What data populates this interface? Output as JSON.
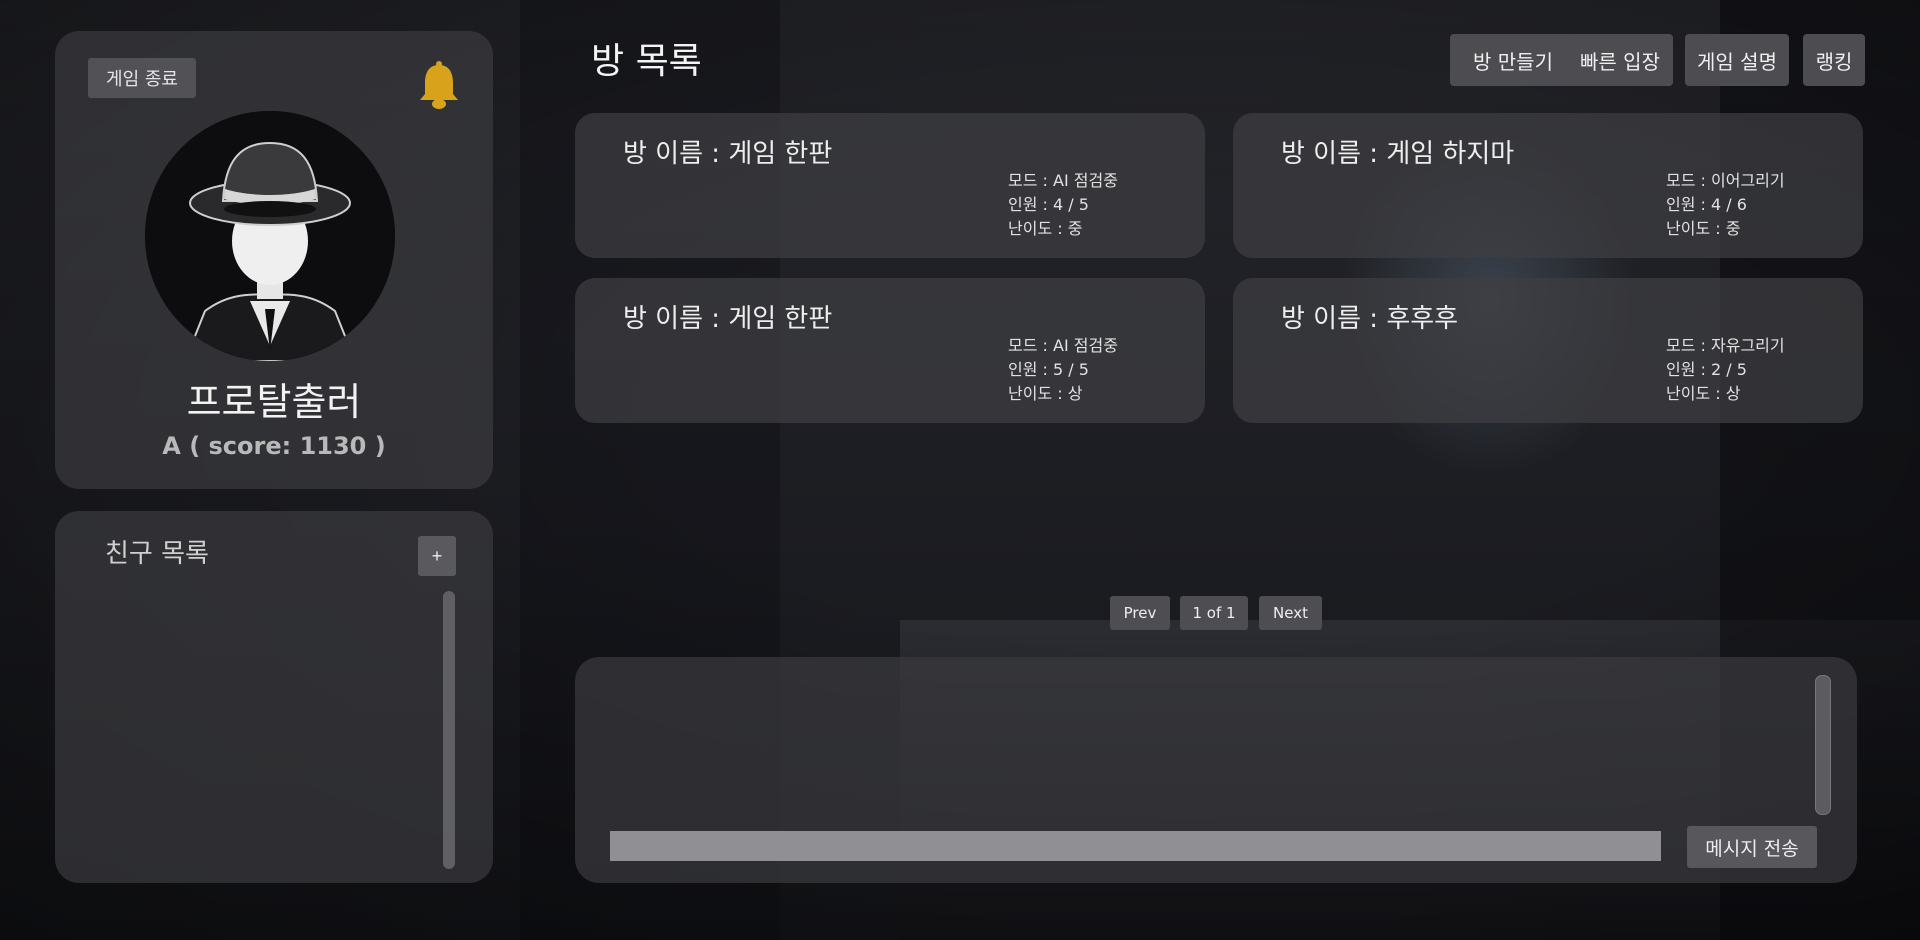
{
  "profile": {
    "exit_label": "게임 종료",
    "nickname": "프로탈출러",
    "score_text": "A ( score: 1130 )",
    "bell_color": "#d9a21b"
  },
  "friends": {
    "title": "친구 목록",
    "add_label": "+"
  },
  "rooms": {
    "title": "방 목록",
    "buttons": {
      "create": "방 만들기",
      "quick": "빠른 입장",
      "help": "게임 설명",
      "ranking": "랭킹"
    },
    "list": [
      {
        "name": "방 이름 : 게임 한판",
        "mode": "모드 : AI 점검중",
        "players": "인원 : 4 / 5",
        "difficulty": "난이도 : 중"
      },
      {
        "name": "방 이름 : 게임 하지마",
        "mode": "모드 : 이어그리기",
        "players": "인원 : 4 / 6",
        "difficulty": "난이도 : 중"
      },
      {
        "name": "방 이름 : 게임 한판",
        "mode": "모드 : AI 점검중",
        "players": "인원 : 5 / 5",
        "difficulty": "난이도 : 상"
      },
      {
        "name": "방 이름 : 후후후",
        "mode": "모드 : 자유그리기",
        "players": "인원 : 2 / 5",
        "difficulty": "난이도 : 상"
      }
    ]
  },
  "pagination": {
    "prev": "Prev",
    "info": "1 of 1",
    "next": "Next"
  },
  "chat": {
    "send_label": "메시지 전송",
    "input_value": ""
  }
}
